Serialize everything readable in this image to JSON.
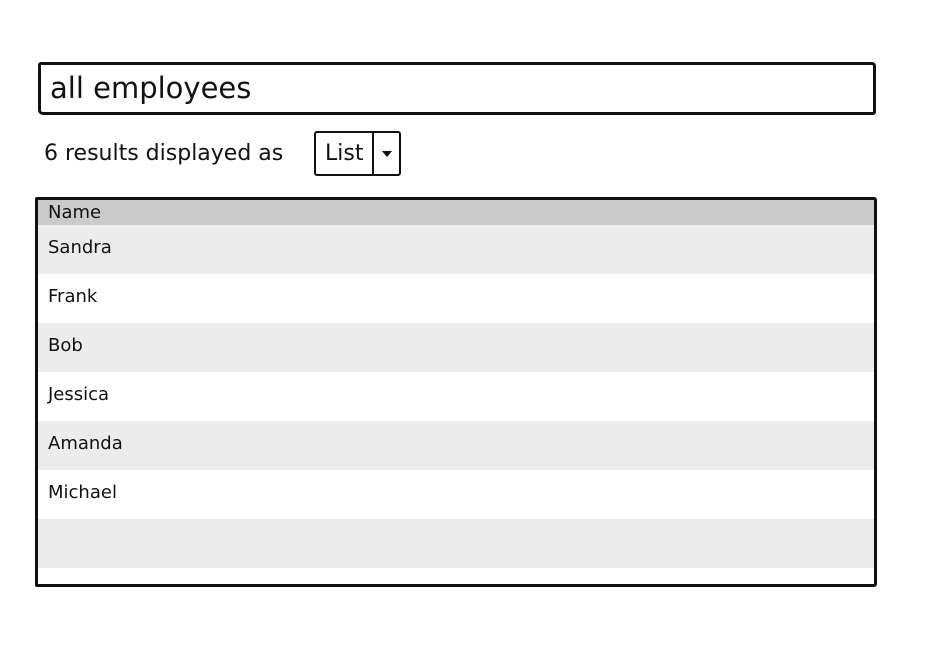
{
  "search": {
    "value": "all employees"
  },
  "results": {
    "label": "6 results displayed as",
    "view_mode": {
      "selected": "List",
      "arrow_icon": "chevron-down-icon"
    }
  },
  "table": {
    "column_header": "Name",
    "rows": [
      "Sandra",
      "Frank",
      "Bob",
      "Jessica",
      "Amanda",
      "Michael"
    ],
    "colors": {
      "header_background": "#cbcbcb",
      "row_striped": "#ececec",
      "row_plain": "#ffffff"
    }
  }
}
